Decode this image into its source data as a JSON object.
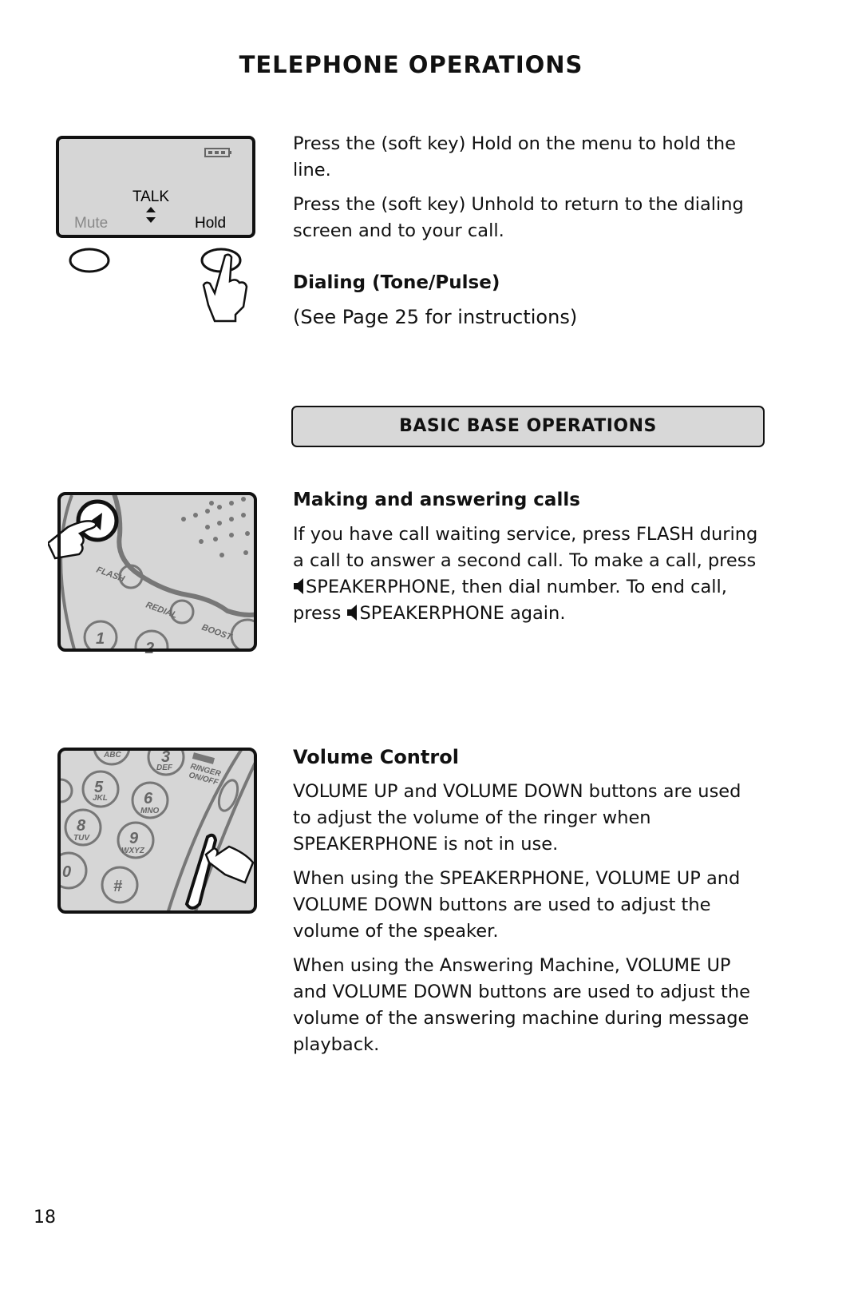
{
  "page_title": "TELEPHONE OPERATIONS",
  "handset_display": {
    "status": "TALK",
    "left_softkey": "Mute",
    "right_softkey": "Hold"
  },
  "hold_section": {
    "para1": "Press the (soft key) Hold on the menu to hold the line.",
    "para2": "Press the (soft key) Unhold to return to the dialing screen and to your call."
  },
  "dialing_section": {
    "heading": "Dialing (Tone/Pulse)",
    "text": "(See Page 25 for instructions)"
  },
  "banner": "BASIC BASE OPERATIONS",
  "base_illustration": {
    "flash": "FLASH",
    "redial": "REDIAL",
    "boost": "BOOST",
    "key1": "1",
    "key2": "2"
  },
  "calls_section": {
    "heading": "Making and answering calls",
    "text_a": "If you have call waiting service, press FLASH during a call to answer a second call. To make a call, press",
    "text_b": "SPEAKERPHONE, then dial number. To end call, press",
    "text_c": "SPEAKERPHONE again."
  },
  "keypad_illustration": {
    "abc": "ABC",
    "k3": "3",
    "def": "DEF",
    "ringer": "RINGER",
    "onoff": "ON/OFF",
    "k5": "5",
    "jkl": "JKL",
    "k6": "6",
    "mno": "MNO",
    "k8": "8",
    "tuv": "TUV",
    "k9": "9",
    "wxyz": "WXYZ",
    "k0": "0",
    "hash": "#"
  },
  "volume_section": {
    "heading": "Volume Control",
    "para1": "VOLUME UP and VOLUME DOWN buttons are used to adjust the volume of the ringer when SPEAKERPHONE is not in use.",
    "para2": "When using the SPEAKERPHONE, VOLUME UP and VOLUME DOWN buttons are used to adjust the volume of the speaker.",
    "para3": "When using the Answering Machine, VOLUME UP and VOLUME DOWN buttons are used to adjust the volume of the answering machine during message playback."
  },
  "page_number": "18",
  "colors": {
    "illustration_gray": "#d6d6d6",
    "line_gray": "#777777"
  }
}
